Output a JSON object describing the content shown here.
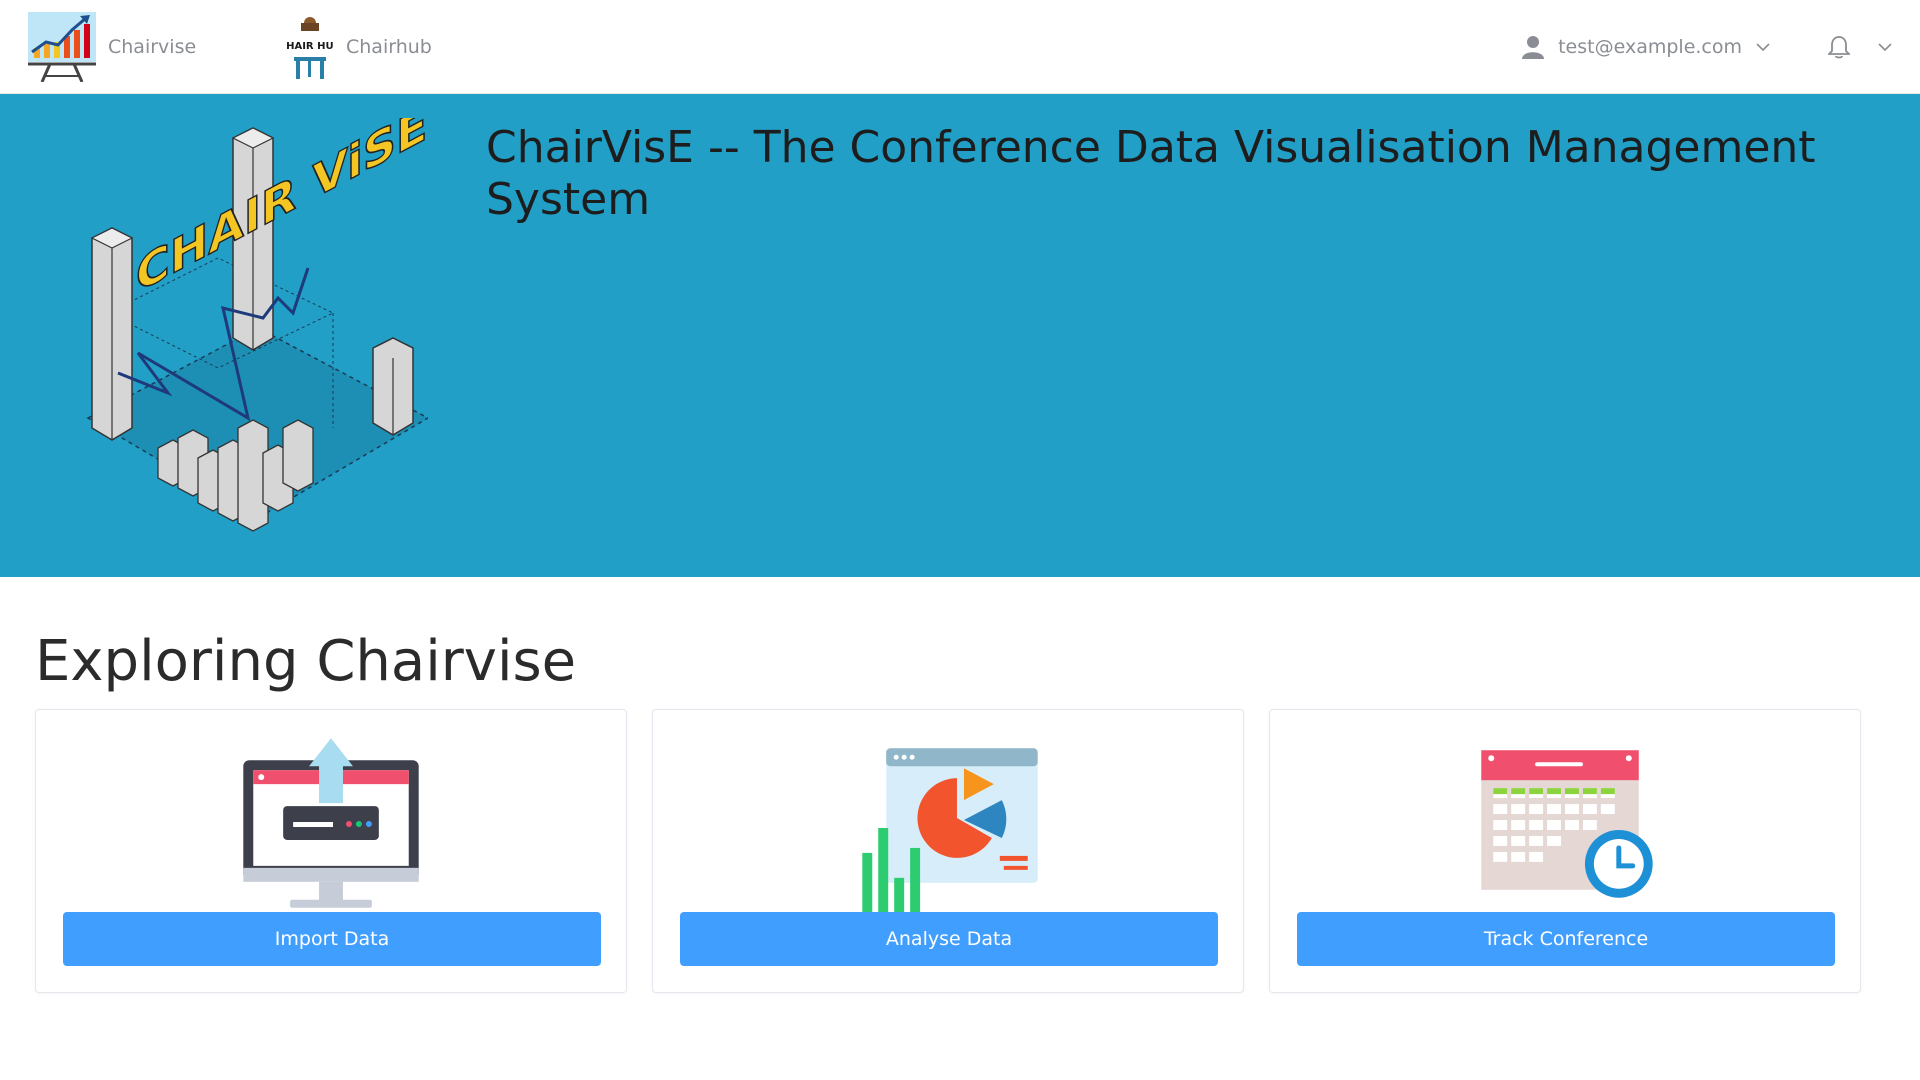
{
  "nav": {
    "brand_chairvise": "Chairvise",
    "brand_chairhub": "Chairhub",
    "chairhub_logo_text": "CHAIR HUB",
    "user_email": "test@example.com"
  },
  "hero": {
    "title": "ChairVisE -- The Conference Data Visualisation Management System",
    "logo_text": "CHAIR ViSE"
  },
  "section": {
    "title": "Exploring Chairvise"
  },
  "cards": [
    {
      "button_label": "Import Data",
      "icon": "monitor-upload-icon"
    },
    {
      "button_label": "Analyse Data",
      "icon": "analytics-chart-icon"
    },
    {
      "button_label": "Track Conference",
      "icon": "calendar-clock-icon"
    }
  ],
  "colors": {
    "hero_bg": "#219fc7",
    "button_bg": "#409eff",
    "nav_text": "#8a8d93"
  }
}
